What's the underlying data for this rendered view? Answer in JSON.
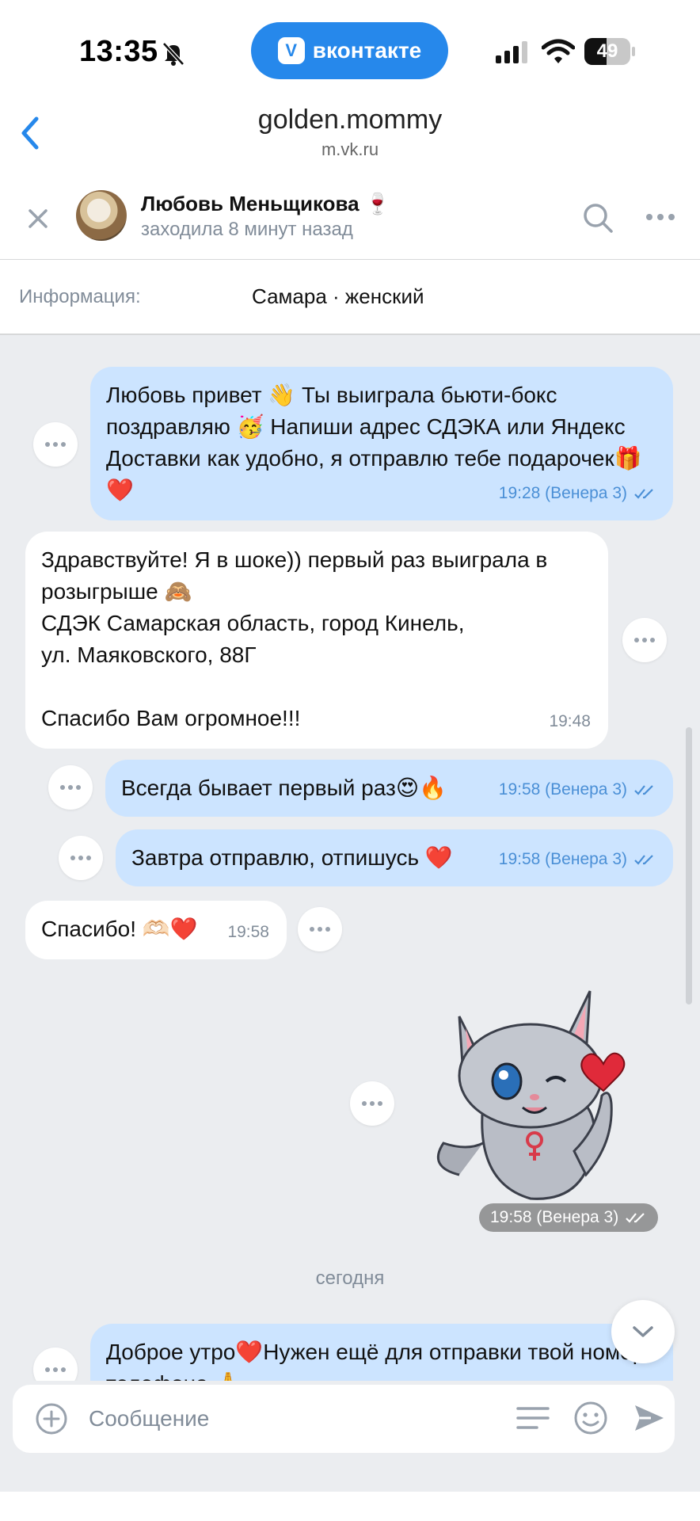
{
  "status_bar": {
    "time": "13:35",
    "app_pill_label": "вконтакте",
    "battery_level": "49",
    "battery_fraction": 0.49
  },
  "browser": {
    "title": "golden.mommy",
    "url": "m.vk.ru"
  },
  "chat_header": {
    "contact_name": "Любовь Меньщикова 🍷",
    "contact_status": "заходила 8 минут назад"
  },
  "info": {
    "label": "Информация:",
    "value": "Самара · женский"
  },
  "messages": [
    {
      "direction": "out",
      "text": "Любовь привет 👋 Ты выиграла бьюти-бокс поздравляю 🥳 Напиши адрес СДЭКА или Яндекс Доставки как удобно, я отправлю тебе подарочек🎁❤️",
      "meta": "19:28 (Венера 3)"
    },
    {
      "direction": "in",
      "text": "Здравствуйте! Я в шоке)) первый раз выиграла в розыгрыше 🙈\nСДЭК Самарская область, город Кинель,\nул. Маяковского, 88Г\n\nСпасибо Вам огромное!!!",
      "meta": "19:48"
    },
    {
      "direction": "out",
      "text": "Всегда бывает первый раз😍🔥",
      "meta": "19:58 (Венера 3)"
    },
    {
      "direction": "out",
      "text": "Завтра отправлю, отпишусь ❤️",
      "meta": "19:58 (Венера 3)"
    },
    {
      "direction": "in",
      "text": "Спасибо! 🫶🏻❤️",
      "meta": "19:58"
    },
    {
      "direction": "out",
      "text": "",
      "meta": "19:58 (Венера 3)",
      "sticker": "grey-cat-heart-sticker"
    },
    {
      "direction": "out",
      "text": "Доброе утро❤️Нужен ещё для отправки твой номер телефона 🙏",
      "meta": ""
    }
  ],
  "date_divider": "сегодня",
  "composer": {
    "placeholder": "Сообщение"
  },
  "colors": {
    "accent": "#2688eb",
    "outgoing_bubble": "#cce4ff",
    "incoming_bubble": "#ffffff",
    "chat_background": "#ebedf0",
    "secondary_text": "#818c99"
  },
  "icons": [
    "bell-slash-icon",
    "vk-logo-icon",
    "signal-icon",
    "wifi-icon",
    "battery-icon",
    "back-chevron-icon",
    "close-icon",
    "search-icon",
    "more-icon",
    "double-check-icon",
    "chevron-down-icon",
    "plus-icon",
    "template-icon",
    "smile-icon",
    "send-icon"
  ]
}
